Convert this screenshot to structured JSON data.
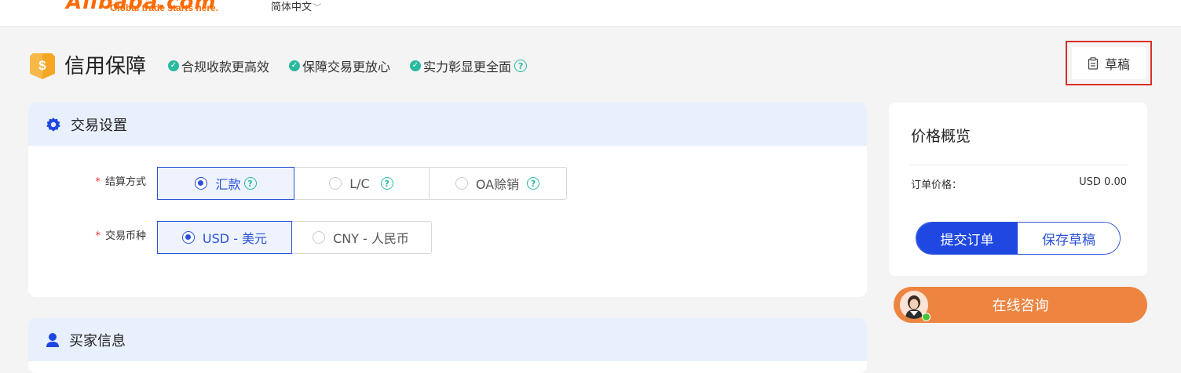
{
  "header": {
    "logo_text": "Alibaba.com",
    "logo_tagline": "Global trade starts here.",
    "language": "简体中文"
  },
  "page": {
    "title": "信用保障",
    "features": [
      "合规收款更高效",
      "保障交易更放心",
      "实力彰显更全面"
    ],
    "draft_label": "草稿"
  },
  "trade_settings": {
    "section_title": "交易设置",
    "payment_method": {
      "label": "结算方式",
      "options": [
        "汇款",
        "L/C",
        "OA赊销"
      ],
      "selected": "汇款"
    },
    "currency": {
      "label": "交易币种",
      "options": [
        "USD - 美元",
        "CNY - 人民币"
      ],
      "selected": "USD - 美元"
    }
  },
  "buyer_info": {
    "section_title": "买家信息"
  },
  "price_overview": {
    "title": "价格概览",
    "order_price_label": "订单价格：",
    "order_price_value": "USD 0.00",
    "submit_label": "提交订单",
    "save_label": "保存草稿"
  },
  "consult": {
    "label": "在线咨询"
  },
  "colors": {
    "accent": "#1f48e2",
    "check": "#2bb9a0",
    "consult": "#ed8440",
    "highlight_box": "#d93025"
  }
}
